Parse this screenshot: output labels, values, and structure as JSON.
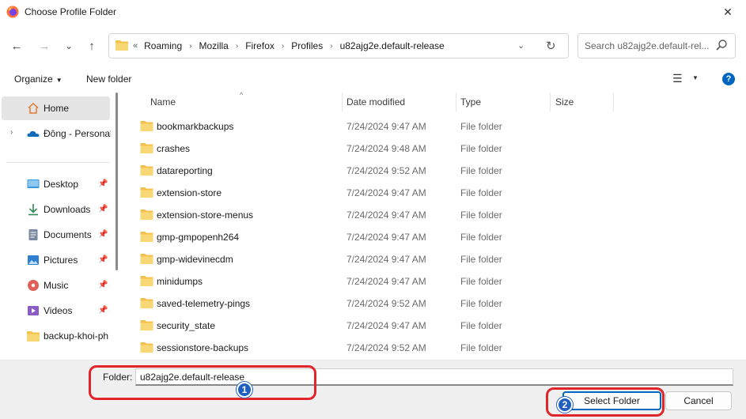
{
  "window": {
    "title": "Choose Profile Folder",
    "close_glyph": "✕"
  },
  "nav": {
    "back_glyph": "←",
    "forward_glyph": "→",
    "recent_glyph": "⌄",
    "up_glyph": "↑",
    "lead_glyph": "«",
    "breadcrumbs": [
      "Roaming",
      "Mozilla",
      "Firefox",
      "Profiles",
      "u82ajg2e.default-release"
    ],
    "separator_glyph": "›",
    "dropdown_glyph": "⌄",
    "refresh_glyph": "↻"
  },
  "search": {
    "placeholder": "Search u82ajg2e.default-rel..."
  },
  "toolbar": {
    "organize_label": "Organize",
    "organize_caret": "▼",
    "new_folder_label": "New folder",
    "view_glyph": "☰",
    "view_caret": "▼",
    "help_glyph": "?"
  },
  "sidebar": {
    "home": "Home",
    "onedrive": "Đông - Personal",
    "expand_glyph": "›",
    "pin_glyph": "📌",
    "quick_access": [
      {
        "label": "Desktop",
        "icon": "desktop-icon",
        "color": "#3a96dd"
      },
      {
        "label": "Downloads",
        "icon": "downloads-icon",
        "color": "#2e8b57"
      },
      {
        "label": "Documents",
        "icon": "documents-icon",
        "color": "#7a8aa0"
      },
      {
        "label": "Pictures",
        "icon": "pictures-icon",
        "color": "#2f7fd1"
      },
      {
        "label": "Music",
        "icon": "music-icon",
        "color": "#e0605a"
      },
      {
        "label": "Videos",
        "icon": "videos-icon",
        "color": "#8b5cc7"
      },
      {
        "label": "backup-khoi-ph",
        "icon": "folder-icon",
        "color": "#f2c14e"
      }
    ]
  },
  "columns": {
    "sort_glyph": "^",
    "name": "Name",
    "date": "Date modified",
    "type": "Type",
    "size": "Size"
  },
  "files": [
    {
      "name": "bookmarkbackups",
      "date": "7/24/2024 9:47 AM",
      "type": "File folder"
    },
    {
      "name": "crashes",
      "date": "7/24/2024 9:48 AM",
      "type": "File folder"
    },
    {
      "name": "datareporting",
      "date": "7/24/2024 9:52 AM",
      "type": "File folder"
    },
    {
      "name": "extension-store",
      "date": "7/24/2024 9:47 AM",
      "type": "File folder"
    },
    {
      "name": "extension-store-menus",
      "date": "7/24/2024 9:47 AM",
      "type": "File folder"
    },
    {
      "name": "gmp-gmpopenh264",
      "date": "7/24/2024 9:47 AM",
      "type": "File folder"
    },
    {
      "name": "gmp-widevinecdm",
      "date": "7/24/2024 9:47 AM",
      "type": "File folder"
    },
    {
      "name": "minidumps",
      "date": "7/24/2024 9:47 AM",
      "type": "File folder"
    },
    {
      "name": "saved-telemetry-pings",
      "date": "7/24/2024 9:52 AM",
      "type": "File folder"
    },
    {
      "name": "security_state",
      "date": "7/24/2024 9:47 AM",
      "type": "File folder"
    },
    {
      "name": "sessionstore-backups",
      "date": "7/24/2024 9:52 AM",
      "type": "File folder"
    }
  ],
  "footer": {
    "folder_label": "Folder:",
    "folder_value": "u82ajg2e.default-release",
    "select_label": "Select Folder",
    "cancel_label": "Cancel"
  },
  "annotations": {
    "marker_1": "1",
    "marker_2": "2",
    "highlight_color": "#e1262b",
    "marker_color": "#1f5fbf"
  },
  "colors": {
    "folder": "#f2c14e",
    "accent": "#0067c0"
  }
}
